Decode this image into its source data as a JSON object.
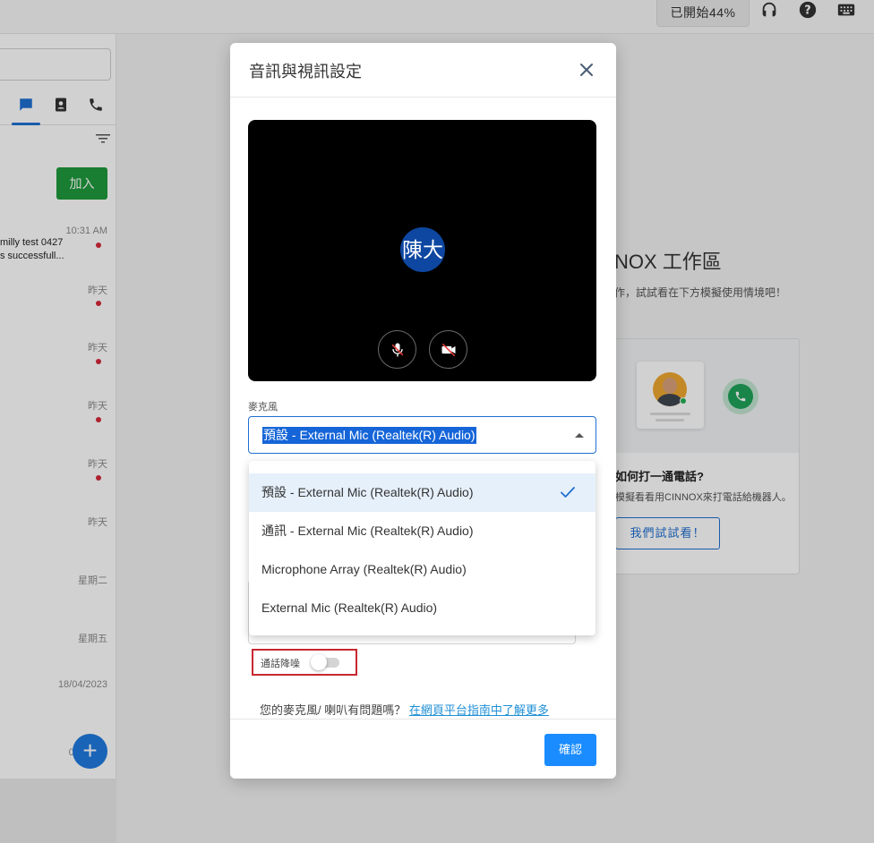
{
  "topbar": {
    "progress_text": "已開始44%"
  },
  "sidebar": {
    "join_label": "加入",
    "conversations": [
      {
        "time": "10:31 AM",
        "line1": "milly test 0427",
        "line2": "s successfull...",
        "unread": true
      },
      {
        "time": "昨天",
        "unread": true
      },
      {
        "time": "昨天",
        "unread": true
      },
      {
        "time": "昨天",
        "unread": true
      },
      {
        "time": "昨天",
        "unread": true
      },
      {
        "time": "昨天",
        "unread": false
      },
      {
        "time": "星期二",
        "unread": false
      },
      {
        "time": "星期五",
        "unread": false
      },
      {
        "time": "18/04/2023",
        "unread": false
      },
      {
        "time": "03/",
        "unread": false
      }
    ],
    "fab_label": "+"
  },
  "workspace": {
    "title": "NOX 工作區",
    "subtitle": "作，試試看在下方模擬使用情境吧！",
    "card": {
      "title": "如何打一通電話?",
      "description": "模擬看看用CINNOX來打電話給機器人。",
      "button_label": "我們試試看！"
    }
  },
  "modal": {
    "title": "音訊與視訊設定",
    "avatar_initials": "陳大",
    "microphone_label": "麥克風",
    "microphone_selected": "預設 - External Mic (Realtek(R) Audio)",
    "microphone_options": [
      "預設 - External Mic (Realtek(R) Audio)",
      "通訊 - External Mic (Realtek(R) Audio)",
      "Microphone Array (Realtek(R) Audio)",
      "External Mic (Realtek(R) Audio)"
    ],
    "noise_suppression_label": "通話降噪",
    "noise_suppression_on": false,
    "help_text": "您的麥克風/ 喇叭有問題嗎？",
    "help_link": "在網頁平台指南中了解更多",
    "confirm_label": "確認"
  },
  "colors": {
    "accent": "#1a8cff",
    "link": "#1f8fd6",
    "join_green": "#1f9a3c",
    "avatar_blue": "#0d47a1",
    "highlight_red": "#c9272f"
  },
  "icons": {
    "topbar": [
      "headset-icon",
      "help-icon",
      "keyboard-icon"
    ],
    "side_tabs": [
      "chat-icon",
      "contacts-icon",
      "phone-icon"
    ],
    "preview": [
      "mic-off-icon",
      "video-off-icon"
    ]
  }
}
